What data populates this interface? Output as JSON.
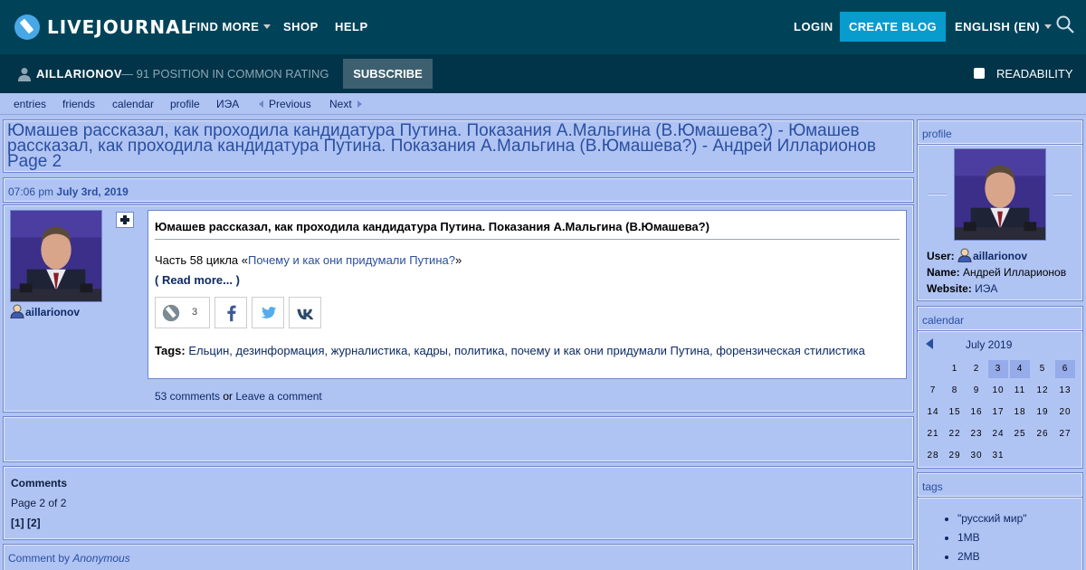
{
  "topnav": {
    "logo_text": "LIVEJOURNAL",
    "find_more": "FIND MORE",
    "shop": "SHOP",
    "help": "HELP",
    "login": "LOGIN",
    "create_blog": "CREATE BLOG",
    "language": "ENGLISH (EN)"
  },
  "subbar": {
    "username": "AILLARIONOV",
    "rating": "— 91 POSITION IN COMMON RATING",
    "subscribe": "SUBSCRIBE",
    "readability": "READABILITY"
  },
  "links": {
    "entries": "entries",
    "friends": "friends",
    "calendar": "calendar",
    "profile": "profile",
    "iea": "ИЭА",
    "previous": "Previous",
    "next": "Next"
  },
  "page_title": "Юмашев рассказал, как проходила кандидатура Путина. Показания А.Мальгина (В.Юмашева?) - Юмашев рассказал, как проходила кандидатура Путина. Показания А.Мальгина (В.Юмашева?) - Андрей Илларионов Page 2",
  "entry": {
    "time": "07:06 pm",
    "date": "July 3rd, 2019",
    "author": "aillarionov",
    "subject": "Юмашев рассказал, как проходила кандидатура Путина. Показания А.Мальгина (В.Юмашева?)",
    "body_prefix": "Часть 58 цикла «",
    "body_link": "Почему и как они придумали Путина?",
    "body_suffix": "»",
    "read_more": "( Read more... )",
    "share_count": "3",
    "tags_label": "Tags:",
    "tags": "Ельцин, дезинформация, журналистика, кадры, политика, почему и как они придумали Путина, форензическая стилистика",
    "comments_link": "53 comments",
    "or": " or ",
    "leave_comment": "Leave a comment"
  },
  "comments": {
    "heading": "Comments",
    "page": "Page 2 of 2",
    "pages": "[1] [2]",
    "comment_by": "Comment by ",
    "anonymous": "Anonymous"
  },
  "sidebar": {
    "profile_hdr": "profile",
    "user_lbl": "User:",
    "user_val": "aillarionov",
    "name_lbl": "Name:",
    "name_val": "Андрей Илларионов",
    "site_lbl": "Website:",
    "site_val": "ИЭА",
    "calendar_hdr": "calendar",
    "month": "July 2019",
    "days": [
      [
        "",
        "1",
        "2",
        "3",
        "4",
        "5",
        "6"
      ],
      [
        "7",
        "8",
        "9",
        "10",
        "11",
        "12",
        "13"
      ],
      [
        "14",
        "15",
        "16",
        "17",
        "18",
        "19",
        "20"
      ],
      [
        "21",
        "22",
        "23",
        "24",
        "25",
        "26",
        "27"
      ],
      [
        "28",
        "29",
        "30",
        "31",
        "",
        "",
        ""
      ]
    ],
    "tags_hdr": "tags",
    "tags": [
      "\"русский мир\"",
      "1MB",
      "2MB"
    ]
  },
  "colors": {
    "topbar": "#004359",
    "subbar": "#013449",
    "accent": "#079bce",
    "page_bg": "#b0c4f4"
  }
}
